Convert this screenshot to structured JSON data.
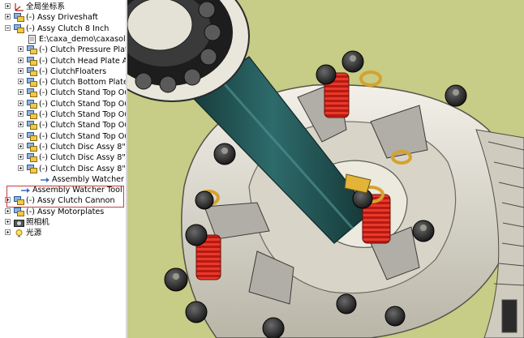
{
  "tree": {
    "items": [
      {
        "label": "全局坐标系",
        "icon": "axis-icon",
        "indent": 0,
        "expander": "plus"
      },
      {
        "label": "(-) Assy Driveshaft",
        "icon": "assembly-icon",
        "indent": 0,
        "expander": "plus"
      },
      {
        "label": "(-) Assy Clutch 8 Inch",
        "icon": "assembly-icon",
        "indent": 0,
        "expander": "minus"
      },
      {
        "label": "E:\\caxa_demo\\caxasolid\\",
        "icon": "document-icon",
        "indent": 1,
        "expander": "none"
      },
      {
        "label": "(-) Clutch Pressure Plate A",
        "icon": "assembly-icon",
        "indent": 1,
        "expander": "plus"
      },
      {
        "label": "(-) Clutch Head Plate Assy",
        "icon": "assembly-icon",
        "indent": 1,
        "expander": "plus"
      },
      {
        "label": "(-) ClutchFloaters",
        "icon": "assembly-icon",
        "indent": 1,
        "expander": "plus"
      },
      {
        "label": "(-) Clutch Bottom Plate as",
        "icon": "assembly-icon",
        "indent": 1,
        "expander": "plus"
      },
      {
        "label": "(-) Clutch Stand Top Oute",
        "icon": "assembly-icon",
        "indent": 1,
        "expander": "plus"
      },
      {
        "label": "(-) Clutch Stand Top Oute",
        "icon": "assembly-icon",
        "indent": 1,
        "expander": "plus"
      },
      {
        "label": "(-) Clutch Stand Top Oute",
        "icon": "assembly-icon",
        "indent": 1,
        "expander": "plus"
      },
      {
        "label": "(-) Clutch Stand Top Oute",
        "icon": "assembly-icon",
        "indent": 1,
        "expander": "plus"
      },
      {
        "label": "(-) Clutch Stand Top Oute",
        "icon": "assembly-icon",
        "indent": 1,
        "expander": "plus"
      },
      {
        "label": "(-) Clutch Disc Assy 8\"",
        "icon": "assembly-icon",
        "indent": 1,
        "expander": "plus"
      },
      {
        "label": "(-) Clutch Disc Assy 8\"",
        "icon": "assembly-icon",
        "indent": 1,
        "expander": "plus"
      },
      {
        "label": "(-) Clutch Disc Assy 8\"",
        "icon": "assembly-icon",
        "indent": 1,
        "expander": "plus"
      },
      {
        "label": "Assembly Watcher Tool",
        "icon": "watcher-tool-icon",
        "indent": 2,
        "expander": "none"
      },
      {
        "label": "Assembly Watcher Tool",
        "icon": "watcher-tool-icon",
        "indent": 0.5,
        "expander": "none"
      },
      {
        "label": "(-) Assy Clutch Cannon",
        "icon": "assembly-icon",
        "indent": 0,
        "expander": "plus"
      },
      {
        "label": "(-) Assy Motorplates",
        "icon": "assembly-icon",
        "indent": 0,
        "expander": "plus"
      },
      {
        "label": "照相机",
        "icon": "camera-icon",
        "indent": 0,
        "expander": "plus"
      },
      {
        "label": "光源",
        "icon": "light-icon",
        "indent": 0,
        "expander": "plus"
      }
    ]
  },
  "viewport": {
    "background_color": "#c7cc86",
    "content": "3D clutch assembly model"
  },
  "colors": {
    "highlight_border": "#c83c3c",
    "spring_red": "#d42a1e",
    "shaft_teal": "#245a5a",
    "metal_light": "#e6e4dc"
  }
}
